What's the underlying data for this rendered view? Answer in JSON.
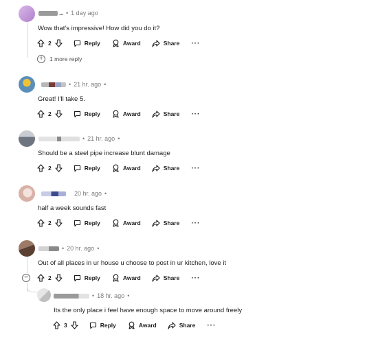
{
  "comments": [
    {
      "username": "...",
      "time": "1 day ago",
      "dot": "•",
      "text": "Wow that's impressive! How did you do it?",
      "votes": "2",
      "reply": "Reply",
      "award": "Award",
      "share": "Share",
      "more": "···",
      "more_replies": "1 more reply"
    },
    {
      "time": "21 hr. ago",
      "dot": "•",
      "text": "Great! I'll take 5.",
      "votes": "2",
      "reply": "Reply",
      "award": "Award",
      "share": "Share",
      "more": "···"
    },
    {
      "time": "21 hr. ago",
      "dot": "•",
      "text": "Should be a steel pipe increase blunt damage",
      "votes": "2",
      "reply": "Reply",
      "award": "Award",
      "share": "Share",
      "more": "···"
    },
    {
      "time": "20 hr. ago",
      "dot": "•",
      "text": "half a week sounds fast",
      "votes": "2",
      "reply": "Reply",
      "award": "Award",
      "share": "Share",
      "more": "···"
    },
    {
      "time": "20 hr. ago",
      "dot": "•",
      "text": "Out of all places in ur house u choose to post in ur kitchen, love it",
      "votes": "2",
      "reply": "Reply",
      "award": "Award",
      "share": "Share",
      "more": "···",
      "collapse": "−"
    },
    {
      "time": "18 hr. ago",
      "dot": "•",
      "text": "Its the only place i feel have enough space to move around freely",
      "votes": "3",
      "reply": "Reply",
      "award": "Award",
      "share": "Share",
      "more": "···"
    }
  ],
  "icons": {
    "upvote": "arrow-up-icon",
    "downvote": "arrow-down-icon",
    "reply": "speech-bubble-icon",
    "award": "award-ribbon-icon",
    "share": "share-arrow-icon",
    "expand": "plus-circle-icon",
    "collapse": "minus-circle-icon"
  },
  "colors": {
    "text": "#1c1c1c",
    "muted": "#7c7c7c",
    "thread_line": "#d6d6d6",
    "avatar_1": "#c9a0dc",
    "avatar_2": "#5b8fb9",
    "avatar_3": "#8a8f99",
    "avatar_4": "#e6c8c0",
    "avatar_5": "#7a5a4a"
  }
}
